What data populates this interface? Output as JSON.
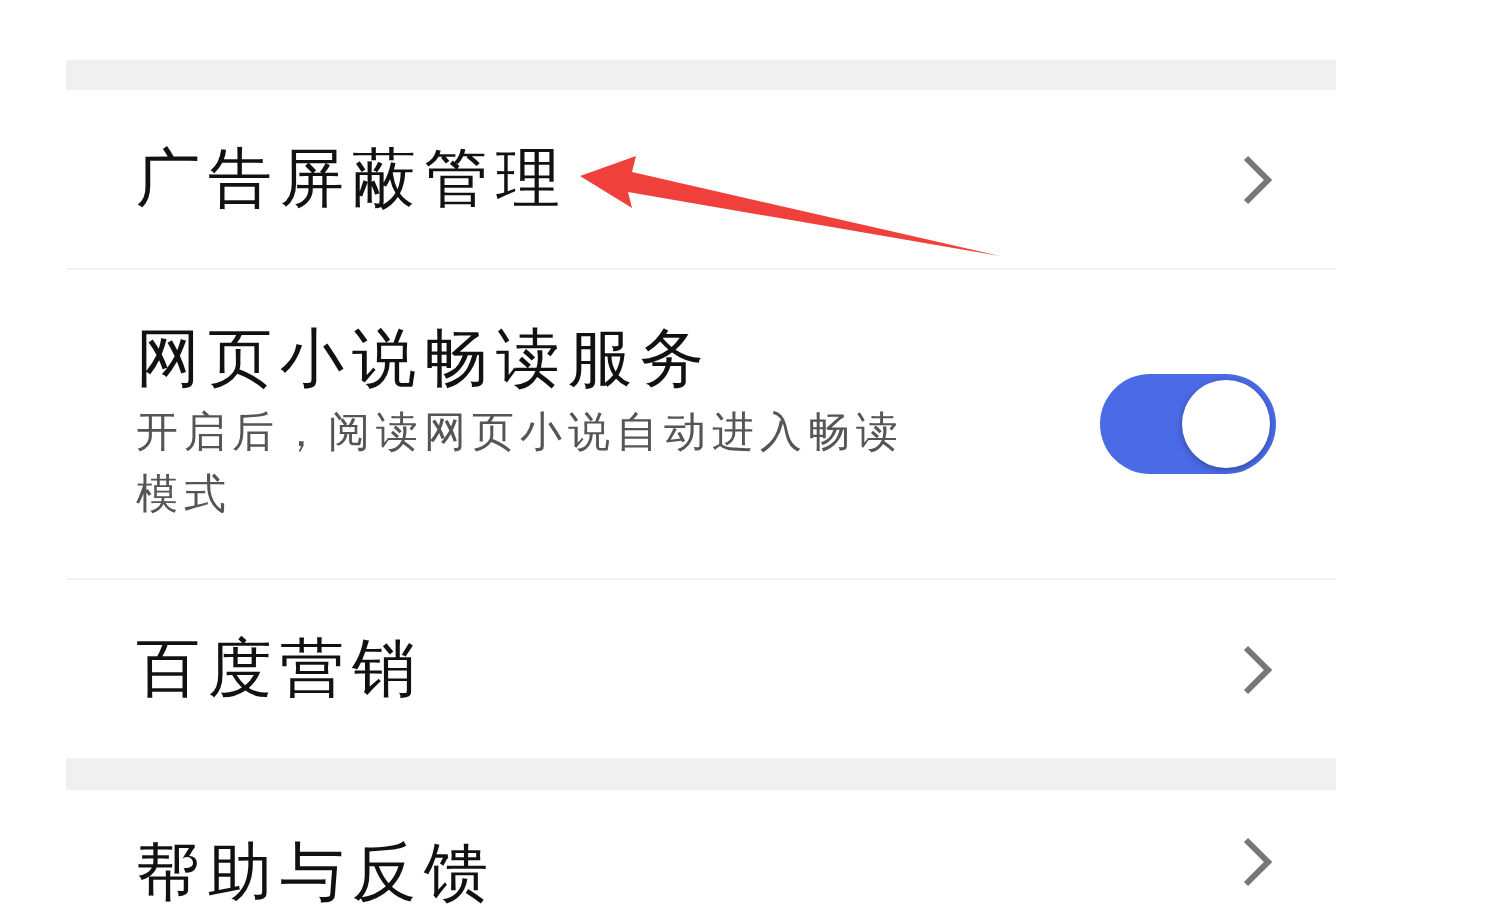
{
  "sections": [
    {
      "items": [
        {
          "kind": "link",
          "title": "广告屏蔽管理"
        },
        {
          "kind": "toggle",
          "title": "网页小说畅读服务",
          "description": "开启后，阅读网页小说自动进入畅读模式",
          "on": true
        },
        {
          "kind": "link",
          "title": "百度营销"
        }
      ]
    },
    {
      "items": [
        {
          "kind": "link",
          "title": "帮助与反馈"
        }
      ]
    }
  ],
  "annotation": {
    "kind": "arrow",
    "color": "#f0403c"
  }
}
